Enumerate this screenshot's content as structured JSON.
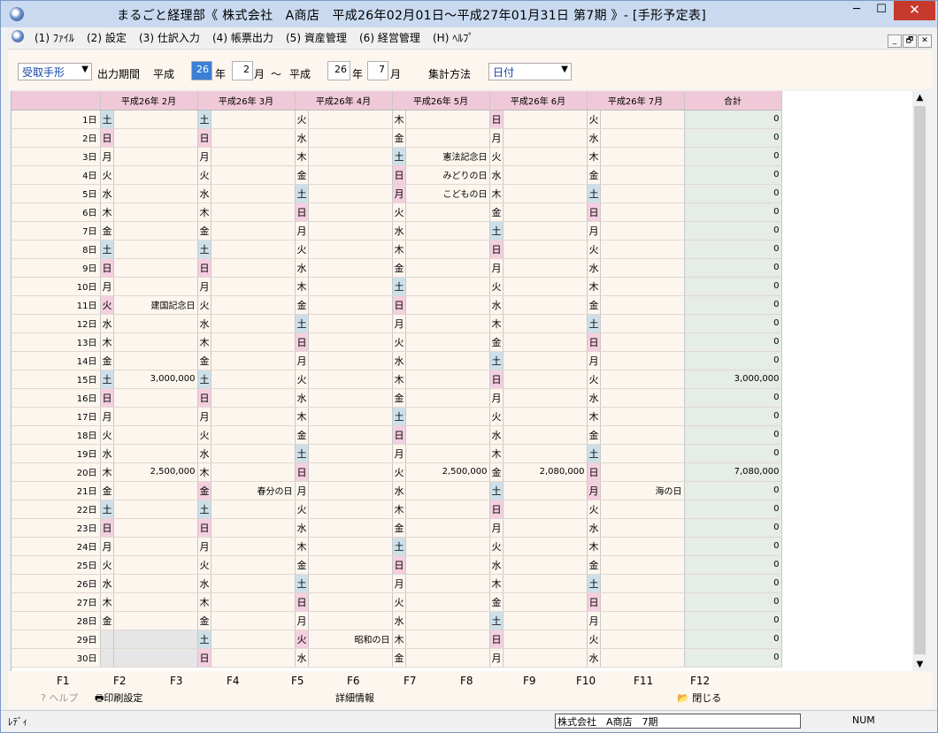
{
  "window": {
    "title": "まるごと経理部《 株式会社　A商店　平成26年02月01日～平成27年01月31日 第7期 》- [手形予定表]",
    "min": "─",
    "max": "☐",
    "close": "✕"
  },
  "menu": [
    "(1) ﾌｧｲﾙ",
    "(2) 設定",
    "(3) 仕訳入力",
    "(4) 帳票出力",
    "(5) 資産管理",
    "(6) 経営管理",
    "(H) ﾍﾙﾌﾟ"
  ],
  "mdi": [
    "_",
    "🗗",
    "✕"
  ],
  "toolbar": {
    "type_select": "受取手形",
    "period_label": "出力期間",
    "era1": "平成",
    "from_year": "26",
    "year1": "年",
    "from_month": "2",
    "month1": "月",
    "tilde": "～",
    "era2": "平成",
    "to_year": "26",
    "year2": "年",
    "to_month": "7",
    "month2": "月",
    "method_label": "集計方法",
    "method_select": "日付"
  },
  "columns": [
    "平成26年 2月",
    "平成26年 3月",
    "平成26年 4月",
    "平成26年 5月",
    "平成26年 6月",
    "平成26年 7月",
    "合計"
  ],
  "days": [
    "1日",
    "2日",
    "3日",
    "4日",
    "5日",
    "6日",
    "7日",
    "8日",
    "9日",
    "10日",
    "11日",
    "12日",
    "13日",
    "14日",
    "15日",
    "16日",
    "17日",
    "18日",
    "19日",
    "20日",
    "21日",
    "22日",
    "23日",
    "24日",
    "25日",
    "26日",
    "27日",
    "28日",
    "29日",
    "30日"
  ],
  "months": [
    {
      "start": 6,
      "len": 28,
      "notes": {
        "11": "建国記念日"
      },
      "values": {
        "15": "3,000,000",
        "20": "2,500,000"
      }
    },
    {
      "start": 6,
      "len": 31,
      "notes": {
        "21": "春分の日"
      },
      "values": {}
    },
    {
      "start": 2,
      "len": 30,
      "notes": {
        "29": "昭和の日"
      },
      "values": {}
    },
    {
      "start": 4,
      "len": 31,
      "notes": {
        "3": "憲法記念日",
        "4": "みどりの日",
        "5": "こどもの日"
      },
      "values": {
        "20": "2,500,000"
      }
    },
    {
      "start": 0,
      "len": 30,
      "notes": {},
      "values": {
        "20": "2,080,000"
      }
    },
    {
      "start": 2,
      "len": 31,
      "notes": {
        "21": "海の日"
      },
      "values": {}
    }
  ],
  "weekday_names": [
    "日",
    "月",
    "火",
    "水",
    "木",
    "金",
    "土"
  ],
  "holidays": {
    "0": [
      11
    ],
    "1": [
      21
    ],
    "2": [
      29
    ],
    "3": [
      3,
      4,
      5
    ],
    "4": [],
    "5": [
      21
    ]
  },
  "totals": [
    "0",
    "0",
    "0",
    "0",
    "0",
    "0",
    "0",
    "0",
    "0",
    "0",
    "0",
    "0",
    "0",
    "0",
    "3,000,000",
    "0",
    "0",
    "0",
    "0",
    "7,080,000",
    "0",
    "0",
    "0",
    "0",
    "0",
    "0",
    "0",
    "0",
    "0",
    "0"
  ],
  "fkeys": [
    "F1",
    "F2",
    "F3",
    "F4",
    "F5",
    "F6",
    "F7",
    "F8",
    "F9",
    "F10",
    "F11",
    "F12"
  ],
  "factions": {
    "help": "ヘルプ",
    "print": "印刷設定",
    "detail": "詳細情報",
    "close": "閉じる"
  },
  "status": {
    "ready": "ﾚﾃﾞｨ",
    "company": "株式会社　A商店　7期",
    "num": "NUM"
  }
}
